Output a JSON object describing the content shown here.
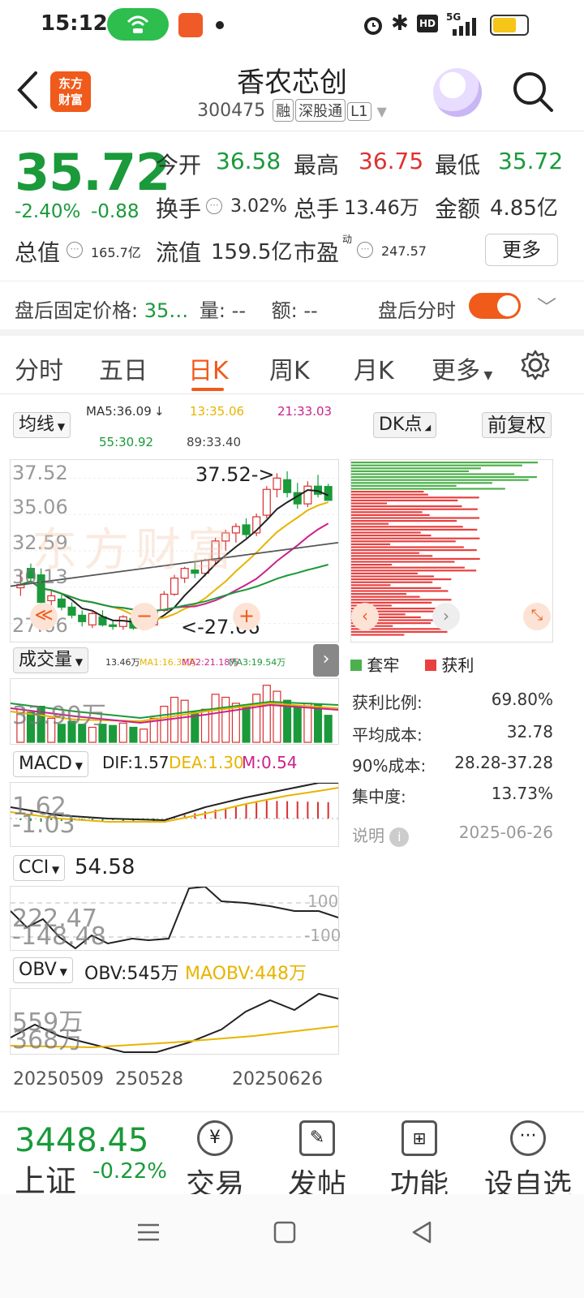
{
  "status_bar": {
    "time": "15:12",
    "network": "5G",
    "hd": "HD"
  },
  "header": {
    "brand": "东方财富",
    "name": "香农芯创",
    "code": "300475",
    "tags": [
      "融",
      "深股通",
      "L1"
    ]
  },
  "quote": {
    "price": "35.72",
    "change_pct": "-2.40%",
    "change": "-0.88",
    "rows": [
      [
        {
          "label": "今开",
          "value": "36.58",
          "color": "down"
        },
        {
          "label": "最高",
          "value": "36.75",
          "color": "up"
        },
        {
          "label": "最低",
          "value": "35.72",
          "color": "down"
        }
      ],
      [
        {
          "label": "换手",
          "value": "3.02%"
        },
        {
          "label": "总手",
          "value": "13.46万"
        },
        {
          "label": "金额",
          "value": "4.85亿"
        }
      ],
      [
        {
          "label": "总值",
          "value": "165.7亿"
        },
        {
          "label": "流值",
          "value": "159.5亿"
        },
        {
          "label": "市盈",
          "sup": "动",
          "value": "247.57"
        }
      ]
    ],
    "more": "更多",
    "after_hours": {
      "label": "盘后固定价格:",
      "price": "35…",
      "vol_label": "量:",
      "vol": "--",
      "amt_label": "额:",
      "amt": "--",
      "toggle_label": "盘后分时"
    }
  },
  "tabs": [
    "分时",
    "五日",
    "日K",
    "周K",
    "月K",
    "更多"
  ],
  "active_tab": "日K",
  "chart": {
    "ma_selector": "均线",
    "ma5": "MA5:36.09",
    "ma13": "13:35.06",
    "ma21": "21:33.03",
    "ma55": "55:30.92",
    "ma89": "89:33.40",
    "dk_btn": "DK点",
    "adjust_btn": "前复权",
    "price_ticks": [
      "37.52",
      "35.06",
      "32.59",
      "30.13",
      "27.66"
    ],
    "high_marker": "37.52->",
    "low_marker": "<-27.66",
    "watermark": "东方财富",
    "volume": {
      "selector": "成交量",
      "items": [
        "13.46万",
        "MA1:16.31万",
        "MA2:21.18万",
        "MA3:19.54万"
      ],
      "max": "33.90万"
    },
    "macd": {
      "selector": "MACD",
      "dif": "DIF:1.57",
      "dea": "DEA:1.30",
      "m": "M:0.54",
      "ticks": [
        "1.62",
        "-1.03"
      ]
    },
    "cci": {
      "selector": "CCI",
      "value": "54.58",
      "ticks": [
        "222.47",
        "-148.48"
      ],
      "ref_hi": "100",
      "ref_lo": "-100"
    },
    "obv": {
      "selector": "OBV",
      "obv": "OBV:545万",
      "maobv": "MAOBV:448万",
      "ticks": [
        "559万",
        "368万"
      ]
    },
    "dates": [
      "20250509",
      "250528",
      "20250626"
    ]
  },
  "chips": {
    "legend_trap": "套牢",
    "legend_profit": "获利",
    "rows": [
      {
        "label": "获利比例:",
        "value": "69.80%"
      },
      {
        "label": "平均成本:",
        "value": "32.78"
      },
      {
        "label": "90%成本:",
        "value": "28.28-37.28"
      },
      {
        "label": "集中度:",
        "value": "13.73%"
      }
    ],
    "note_label": "说明",
    "date": "2025-06-26"
  },
  "bottom_bar": {
    "index_value": "3448.45",
    "index_name": "上证",
    "index_pct": "-0.22%",
    "items": [
      "交易",
      "发帖",
      "功能",
      "设自选"
    ]
  },
  "chart_data": {
    "type": "candlestick",
    "ylim": [
      27.66,
      37.52
    ],
    "candles": [
      [
        30.3,
        31.3,
        29.8,
        30.5
      ],
      [
        31.5,
        31.8,
        30.6,
        30.9
      ],
      [
        31.1,
        31.5,
        29.2,
        29.4
      ],
      [
        29.5,
        30.1,
        28.8,
        29.8
      ],
      [
        29.6,
        29.9,
        28.9,
        29.1
      ],
      [
        29.1,
        29.4,
        28.4,
        28.6
      ],
      [
        28.6,
        28.9,
        27.9,
        28.2
      ],
      [
        28.0,
        28.8,
        27.8,
        28.7
      ],
      [
        28.5,
        28.9,
        27.9,
        28.0
      ],
      [
        28.0,
        28.3,
        27.7,
        27.9
      ],
      [
        27.9,
        28.6,
        27.7,
        28.5
      ],
      [
        28.4,
        28.6,
        27.7,
        27.8
      ],
      [
        27.8,
        28.1,
        27.66,
        28.0
      ],
      [
        28.0,
        28.9,
        27.9,
        28.8
      ],
      [
        28.9,
        30.1,
        28.8,
        29.9
      ],
      [
        29.9,
        31.1,
        29.8,
        30.9
      ],
      [
        30.9,
        31.6,
        30.6,
        31.5
      ],
      [
        31.4,
        31.9,
        30.9,
        31.2
      ],
      [
        31.2,
        32.1,
        31.0,
        32.0
      ],
      [
        32.0,
        33.4,
        31.8,
        33.2
      ],
      [
        33.2,
        33.9,
        32.6,
        33.7
      ],
      [
        33.7,
        34.3,
        33.1,
        34.1
      ],
      [
        34.2,
        34.6,
        33.4,
        33.6
      ],
      [
        33.7,
        34.9,
        33.5,
        34.7
      ],
      [
        34.8,
        36.6,
        34.6,
        36.4
      ],
      [
        36.4,
        37.4,
        35.9,
        37.1
      ],
      [
        37.0,
        37.52,
        35.9,
        36.2
      ],
      [
        36.2,
        36.8,
        35.2,
        35.5
      ],
      [
        35.5,
        36.9,
        35.3,
        36.6
      ],
      [
        36.6,
        37.3,
        35.9,
        36.1
      ],
      [
        36.58,
        36.75,
        35.72,
        35.72
      ]
    ],
    "volume_max": "33.90万",
    "chip_profit_ratio": 69.8,
    "avg_cost": 32.78
  }
}
